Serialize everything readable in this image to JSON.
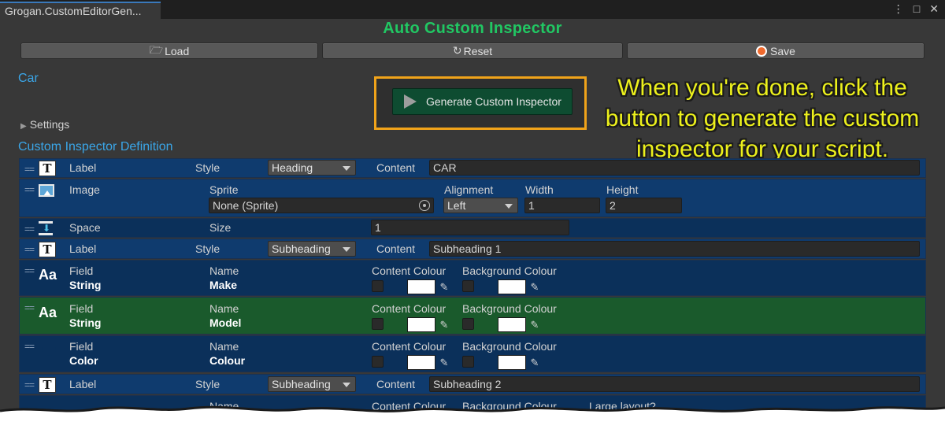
{
  "window": {
    "tab_title": "Grogan.CustomEditorGen...",
    "icons": [
      "more-vert-icon",
      "maximize-icon",
      "close-icon"
    ]
  },
  "title": "Auto Custom Inspector",
  "toolbar": {
    "load": "Load",
    "reset": "Reset",
    "save": "Save"
  },
  "target_name": "Car",
  "generate_button": "Generate Custom Inspector",
  "annotation": "When you're done, click the button to generate the custom inspector for your script.",
  "settings_label": "Settings",
  "definition_label": "Custom Inspector Definition",
  "rows": [
    {
      "type": "Label",
      "style_label": "Style",
      "style_value": "Heading",
      "content_label": "Content",
      "content_value": "CAR"
    },
    {
      "type": "Image",
      "sprite_label": "Sprite",
      "sprite_value": "None (Sprite)",
      "alignment_label": "Alignment",
      "alignment_value": "Left",
      "width_label": "Width",
      "width_value": "1",
      "height_label": "Height",
      "height_value": "2"
    },
    {
      "type": "Space",
      "size_label": "Size",
      "size_value": "1"
    },
    {
      "type": "Label",
      "style_label": "Style",
      "style_value": "Subheading",
      "content_label": "Content",
      "content_value": "Subheading 1"
    },
    {
      "type": "Field",
      "subtype": "String",
      "name_label": "Name",
      "name_value": "Make",
      "content_colour_label": "Content Colour",
      "background_colour_label": "Background Colour"
    },
    {
      "type": "Field",
      "subtype": "String",
      "name_label": "Name",
      "name_value": "Model",
      "content_colour_label": "Content Colour",
      "background_colour_label": "Background Colour"
    },
    {
      "type": "Field",
      "subtype": "Color",
      "name_label": "Name",
      "name_value": "Colour",
      "content_colour_label": "Content Colour",
      "background_colour_label": "Background Colour"
    },
    {
      "type": "Label",
      "style_label": "Style",
      "style_value": "Subheading",
      "content_label": "Content",
      "content_value": "Subheading 2"
    },
    {
      "name_label": "Name",
      "content_colour_label": "Content Colour",
      "background_colour_label": "Background Colour",
      "large_layout_label": "Large layout?"
    }
  ],
  "colors": {
    "title_green": "#21c763",
    "section_blue": "#3aa6e8",
    "callout_orange": "#f0a31a",
    "annotation_yellow": "#ecf01c",
    "row_blue": "#0f3b6e",
    "row_green": "#1a5a2c"
  }
}
